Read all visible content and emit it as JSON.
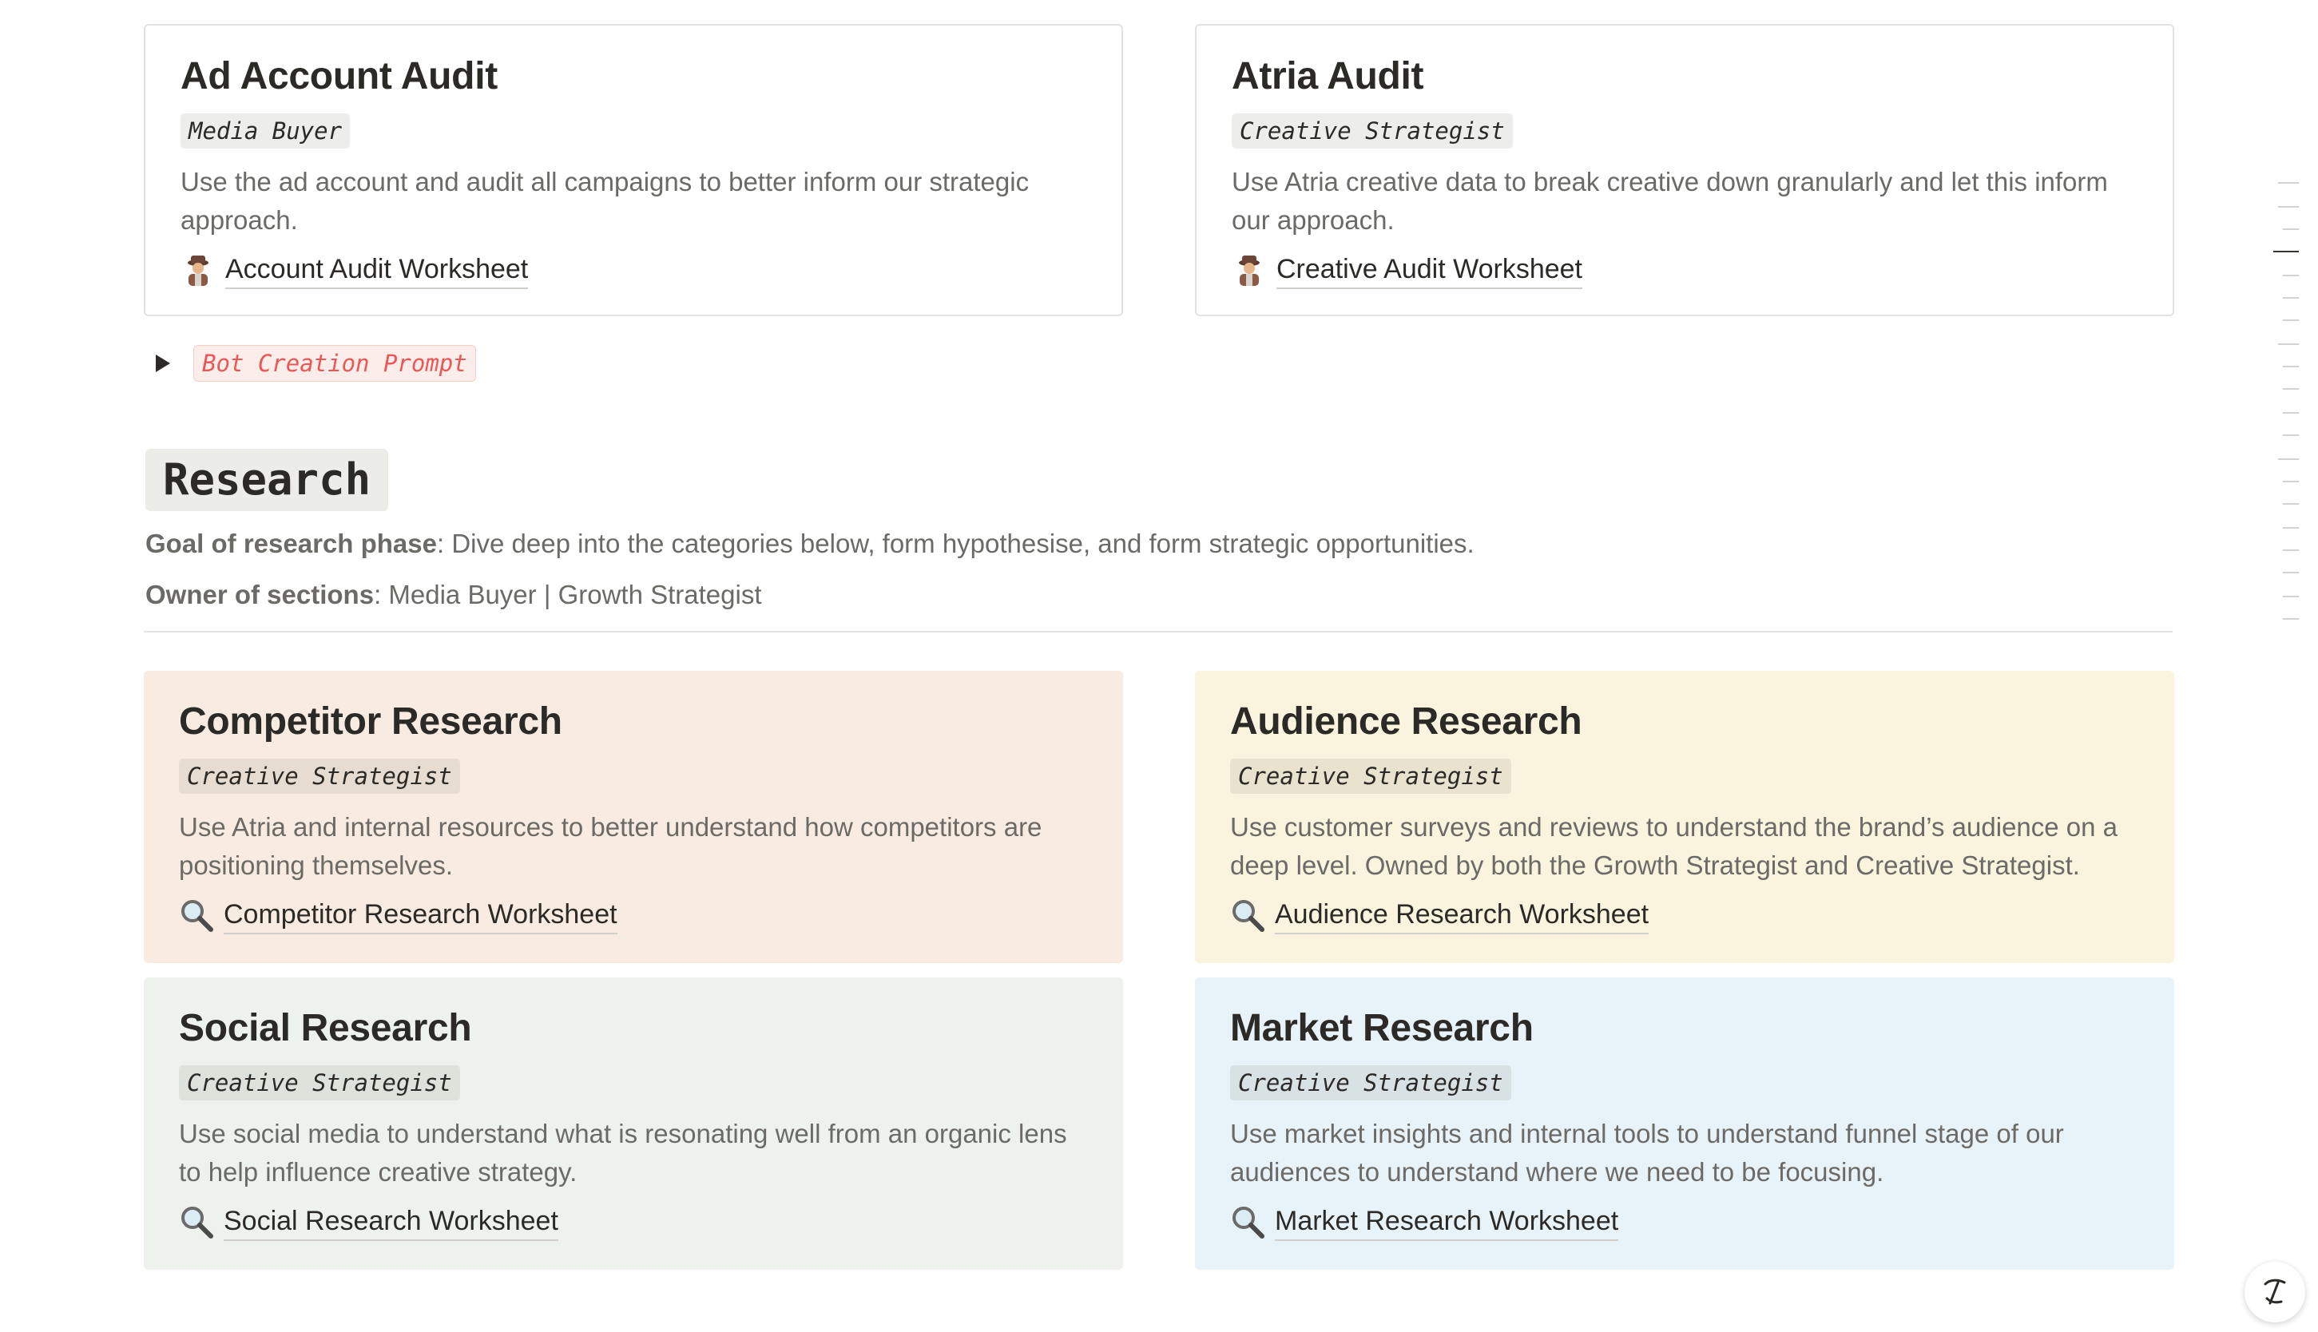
{
  "top_cards": [
    {
      "title": "Ad Account Audit",
      "role": "Media Buyer",
      "description": "Use the ad account and audit all campaigns to better inform our strategic approach.",
      "link_icon": "detective-icon",
      "link_label": "Account Audit Worksheet"
    },
    {
      "title": "Atria Audit",
      "role": "Creative Strategist",
      "description": "Use Atria creative data to break creative down granularly and let this inform our approach.",
      "link_icon": "detective-icon",
      "link_label": "Creative Audit Worksheet"
    }
  ],
  "toggle": {
    "label": "Bot Creation Prompt"
  },
  "research": {
    "heading": "Research",
    "goal_label": "Goal of research phase",
    "goal_text": ": Dive deep into the categories below, form hypothesise, and form strategic opportunities.",
    "owner_label": "Owner of sections",
    "owner_text": ": Media Buyer | Growth Strategist"
  },
  "research_cards": [
    {
      "title": "Competitor Research",
      "role": "Creative Strategist",
      "description": "Use Atria and internal resources to better understand how competitors are positioning themselves.",
      "link_icon": "magnifier-icon",
      "link_label": "Competitor Research Worksheet",
      "bg": "#f8ebe1"
    },
    {
      "title": "Audience Research",
      "role": "Creative Strategist",
      "description": "Use customer surveys and reviews to understand the brand’s audience on a deep level. Owned by both the Growth Strategist and Creative Strategist.",
      "link_icon": "magnifier-icon",
      "link_label": "Audience Research Worksheet",
      "bg": "#faf3dd"
    },
    {
      "title": "Social Research",
      "role": "Creative Strategist",
      "description": "Use social media to understand what is resonating well from an organic lens to help influence creative strategy.",
      "link_icon": "magnifier-icon",
      "link_label": "Social Research Worksheet",
      "bg": "#edf3ec"
    },
    {
      "title": "Market Research",
      "role": "Creative Strategist",
      "description": "Use market insights and internal tools to understand funnel stage of our audiences to understand where we need to be focusing.",
      "link_icon": "magnifier-icon",
      "link_label": "Market Research Worksheet",
      "bg": "#e7f3f8"
    }
  ],
  "colors": {
    "text": "#37352f",
    "muted": "#6b6a66",
    "code_red": "#eb5757"
  }
}
